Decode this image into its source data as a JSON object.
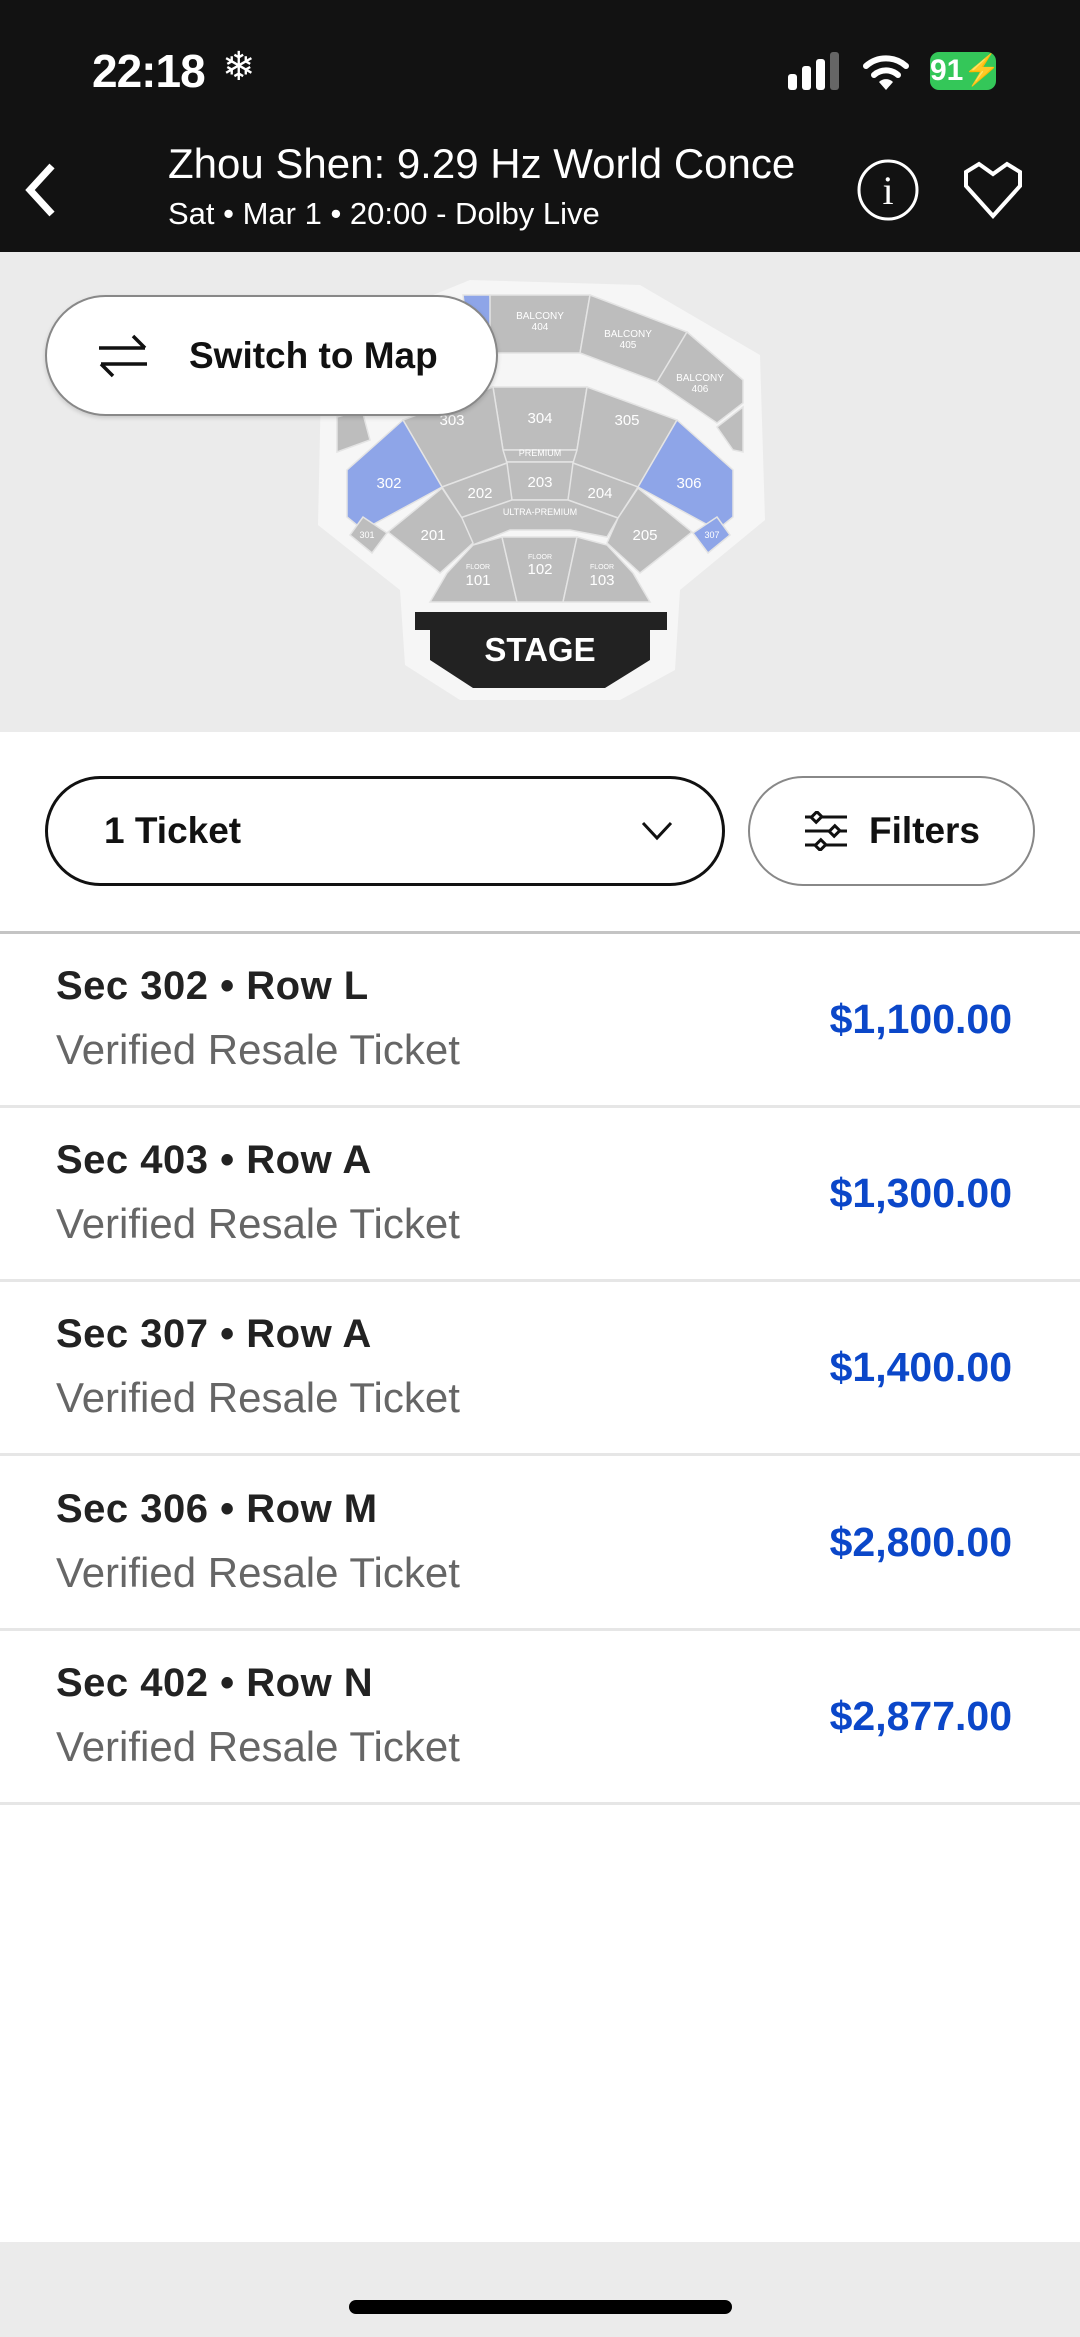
{
  "status_bar": {
    "time": "22:18",
    "battery": "91"
  },
  "header": {
    "title": "Zhou Shen: 9.29 Hz World Conce",
    "subtitle": "Sat • Mar 1 • 20:00 - Dolby Live"
  },
  "map": {
    "switch_label": "Switch to Map",
    "highlight_color": "#8ea5e8",
    "sections": {
      "b404a": "BALCONY",
      "b404b": "404",
      "b405a": "BALCONY",
      "b405b": "405",
      "b406a": "BALCONY",
      "b406b": "406",
      "s304": "304",
      "s305": "305",
      "s303": "303",
      "premium": "PREMIUM",
      "s203": "203",
      "s202": "202",
      "s204": "204",
      "s302": "302",
      "s306": "306",
      "ultra": "ULTRA-PREMIUM",
      "s201": "201",
      "s205": "205",
      "s301": "301",
      "s307": "307",
      "f101a": "FLOOR",
      "f101b": "101",
      "f102a": "FLOOR",
      "f102b": "102",
      "f103a": "FLOOR",
      "f103b": "103",
      "stage": "STAGE"
    }
  },
  "controls": {
    "quantity": "1 Ticket",
    "filters": "Filters"
  },
  "listings": [
    {
      "section": "Sec 302 • Row L",
      "type": "Verified Resale Ticket",
      "price": "$1,100.00"
    },
    {
      "section": "Sec 403 • Row A",
      "type": "Verified Resale Ticket",
      "price": "$1,300.00"
    },
    {
      "section": "Sec 307 • Row A",
      "type": "Verified Resale Ticket",
      "price": "$1,400.00"
    },
    {
      "section": "Sec 306 • Row M",
      "type": "Verified Resale Ticket",
      "price": "$2,800.00"
    },
    {
      "section": "Sec 402 • Row N",
      "type": "Verified Resale Ticket",
      "price": "$2,877.00"
    }
  ],
  "colors": {
    "price": "#0b47c9",
    "header_bg": "#121212"
  }
}
